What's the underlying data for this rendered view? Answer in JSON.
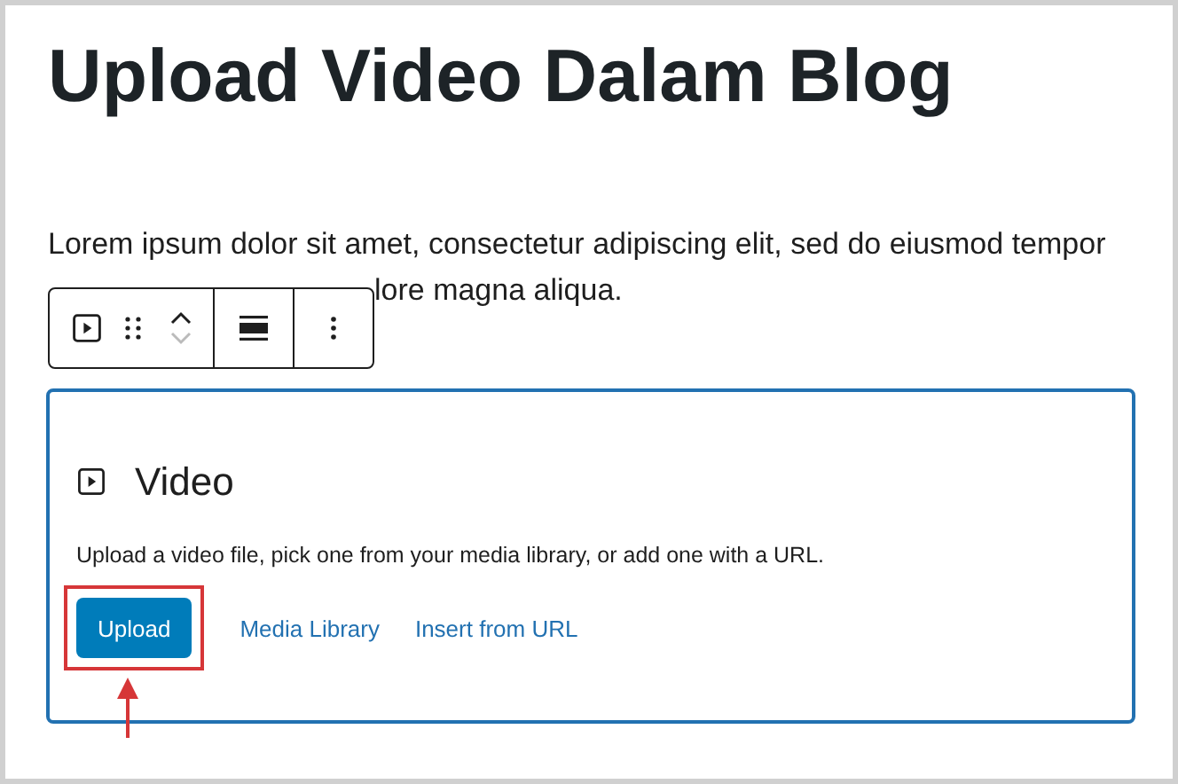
{
  "post_title": "Upload Video Dalam Blog",
  "paragraph_lines": [
    "Lorem ipsum dolor sit amet, consectetur adipiscing elit, sed do eiusmod tempor",
    "lore magna aliqua."
  ],
  "video_block": {
    "title": "Video",
    "instructions": "Upload a video file, pick one from your media library, or add one with a URL.",
    "actions": [
      {
        "label": "Upload",
        "kind": "primary",
        "highlighted": true
      },
      {
        "label": "Media Library",
        "kind": "link",
        "highlighted": false
      },
      {
        "label": "Insert from URL",
        "kind": "link",
        "highlighted": false
      }
    ]
  }
}
